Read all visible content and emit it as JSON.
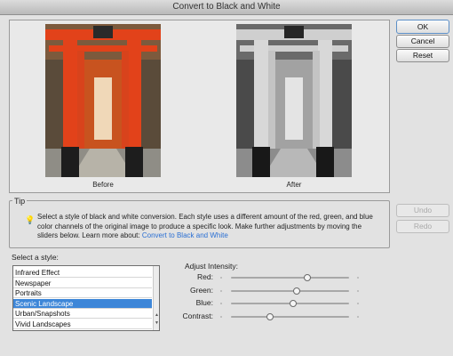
{
  "window": {
    "title": "Convert to Black and White"
  },
  "preview": {
    "before_caption": "Before",
    "after_caption": "After"
  },
  "buttons": {
    "ok": "OK",
    "cancel": "Cancel",
    "reset": "Reset",
    "undo": "Undo",
    "redo": "Redo"
  },
  "tip": {
    "title": "Tip",
    "text": "Select a style of black and white conversion. Each style uses a different amount of the red, green, and blue color channels of the original image to produce a specific look. Make further adjustments by moving the sliders below. Learn more about: ",
    "link": "Convert to Black and White"
  },
  "styles": {
    "label": "Select a style:",
    "items": [
      "Infrared Effect",
      "Newspaper",
      "Portraits",
      "Scenic Landscape",
      "Urban/Snapshots",
      "Vivid Landscapes"
    ],
    "selected": "Scenic Landscape"
  },
  "adjust": {
    "title": "Adjust Intensity:",
    "sliders": [
      {
        "label": "Red:",
        "value": 0.65
      },
      {
        "label": "Green:",
        "value": 0.56
      },
      {
        "label": "Blue:",
        "value": 0.53
      },
      {
        "label": "Contrast:",
        "value": 0.33
      }
    ]
  },
  "colors": {
    "accent": "#3d86d8",
    "link": "#2a6fd3",
    "torii_red": "#e2421a"
  }
}
